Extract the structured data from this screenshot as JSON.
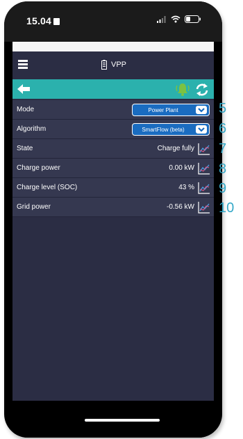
{
  "status_bar": {
    "time": "15.04"
  },
  "header": {
    "title": "VPP"
  },
  "rows": [
    {
      "label": "Mode",
      "value": "Power Plant",
      "kind": "select"
    },
    {
      "label": "Algorithm",
      "value": "SmartFlow (beta)",
      "kind": "select"
    },
    {
      "label": "State",
      "value": "Charge fully",
      "kind": "chart"
    },
    {
      "label": "Charge power",
      "value": "0.00 kW",
      "kind": "chart"
    },
    {
      "label": "Charge level (SOC)",
      "value": "43 %",
      "kind": "chart"
    },
    {
      "label": "Grid power",
      "value": "-0.56 kW",
      "kind": "chart"
    }
  ],
  "annotations": [
    "5",
    "6",
    "7",
    "8",
    "9",
    "10"
  ],
  "colors": {
    "screen_bg": "#2b2d44",
    "row_bg": "#353850",
    "toolbar_teal": "#2bb1ad",
    "select_blue": "#1a6cc0",
    "bell_green": "#7cc242",
    "annotation_blue": "#35a9c8"
  },
  "icons": {
    "menu": "hamburger-icon",
    "battery": "battery-icon",
    "back": "arrow-left-icon",
    "bell": "bell-icon",
    "sync": "sync-icon",
    "chart": "line-chart-icon",
    "chevron": "chevron-down-icon"
  }
}
